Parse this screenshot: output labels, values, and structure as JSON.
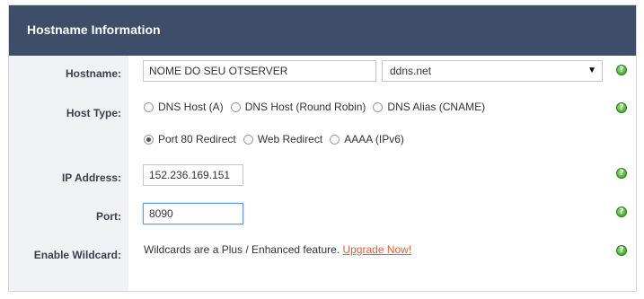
{
  "header": {
    "title": "Hostname Information"
  },
  "hostname": {
    "label": "Hostname:",
    "value": "NOME DO SEU OTSERVER",
    "domain_selected": "ddns.net"
  },
  "host_type": {
    "label": "Host Type:",
    "options": [
      {
        "label": "DNS Host (A)",
        "checked": false
      },
      {
        "label": "DNS Host (Round Robin)",
        "checked": false
      },
      {
        "label": "DNS Alias (CNAME)",
        "checked": false
      },
      {
        "label": "Port 80 Redirect",
        "checked": true
      },
      {
        "label": "Web Redirect",
        "checked": false
      },
      {
        "label": "AAAA (IPv6)",
        "checked": false
      }
    ]
  },
  "ip_address": {
    "label": "IP Address:",
    "value": "152.236.169.151"
  },
  "port": {
    "label": "Port:",
    "value": "8090"
  },
  "wildcard": {
    "label": "Enable Wildcard:",
    "text": "Wildcards are a Plus / Enhanced feature.",
    "link": "Upgrade Now!"
  },
  "icons": {
    "help": "help-icon",
    "dropdown": "chevron-down-icon"
  },
  "colors": {
    "header_bg": "#3e4e68",
    "label_col_bg": "#f1f2f5",
    "link": "#e0622b",
    "help_green": "#3b9a26"
  }
}
